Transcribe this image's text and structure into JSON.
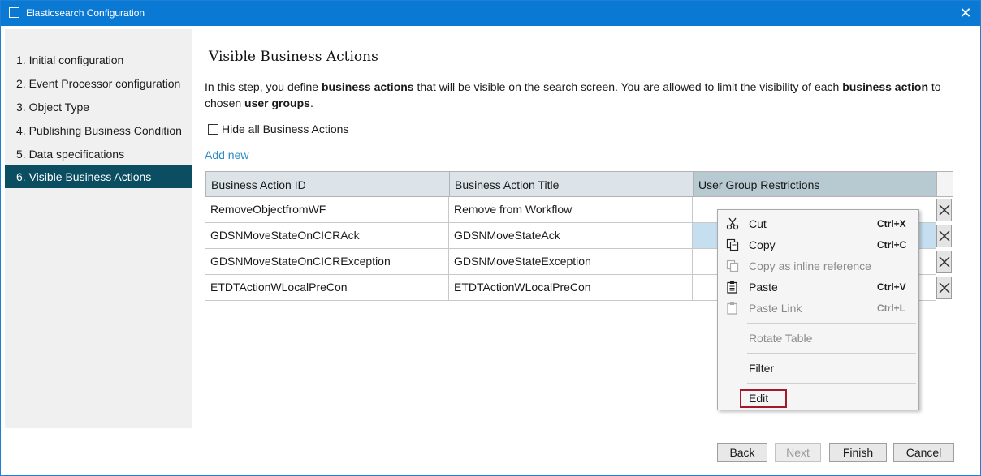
{
  "window": {
    "title": "Elasticsearch Configuration"
  },
  "steps": [
    {
      "label": "1. Initial configuration"
    },
    {
      "label": "2. Event Processor configuration"
    },
    {
      "label": "3. Object Type"
    },
    {
      "label": "4. Publishing Business Condition"
    },
    {
      "label": "5. Data specifications"
    },
    {
      "label": "6. Visible Business Actions"
    }
  ],
  "active_step": 5,
  "main": {
    "heading": "Visible Business Actions",
    "intro": {
      "p1": "In this step, you define ",
      "b1": "business actions",
      "p2": " that will be visible on the search screen. You are allowed to limit the visibility of each ",
      "b2": "business action",
      "p3": " to chosen ",
      "b3": "user groups",
      "p4": "."
    },
    "hide_all_label": "Hide all Business Actions",
    "hide_all_checked": false,
    "add_new": "Add new"
  },
  "table": {
    "columns": [
      "Business Action ID",
      "Business Action Title",
      "User Group Restrictions"
    ],
    "rows": [
      {
        "id": "RemoveObjectfromWF",
        "title": "Remove from Workflow",
        "restrictions": ""
      },
      {
        "id": "GDSNMoveStateOnCICRAck",
        "title": "GDSNMoveStateAck",
        "restrictions": ""
      },
      {
        "id": "GDSNMoveStateOnCICRException",
        "title": "GDSNMoveStateException",
        "restrictions": ""
      },
      {
        "id": "ETDTActionWLocalPreCon",
        "title": "ETDTActionWLocalPreCon",
        "restrictions": ""
      }
    ],
    "selected_row": 1
  },
  "context_menu": {
    "items": [
      {
        "label": "Cut",
        "shortcut": "Ctrl+X",
        "icon": "scissors-icon",
        "enabled": true
      },
      {
        "label": "Copy",
        "shortcut": "Ctrl+C",
        "icon": "copy-icon",
        "enabled": true
      },
      {
        "label": "Copy as inline reference",
        "shortcut": "",
        "icon": "copy-reference-icon",
        "enabled": false
      },
      {
        "label": "Paste",
        "shortcut": "Ctrl+V",
        "icon": "paste-icon",
        "enabled": true
      },
      {
        "label": "Paste Link",
        "shortcut": "Ctrl+L",
        "icon": "paste-link-icon",
        "enabled": false
      },
      {
        "label": "Rotate Table",
        "shortcut": "",
        "icon": "",
        "enabled": false
      },
      {
        "label": "Filter",
        "shortcut": "",
        "icon": "",
        "enabled": true
      },
      {
        "label": "Edit",
        "shortcut": "",
        "icon": "",
        "enabled": true
      }
    ],
    "highlight_color": "#a3192b"
  },
  "footer": {
    "back": "Back",
    "next": "Next",
    "finish": "Finish",
    "cancel": "Cancel",
    "next_enabled": false
  },
  "colors": {
    "titlebar": "#0a79d4",
    "active_step": "#0b4e61",
    "link": "#2a8ac6",
    "selected_cell": "#c6dff0"
  }
}
